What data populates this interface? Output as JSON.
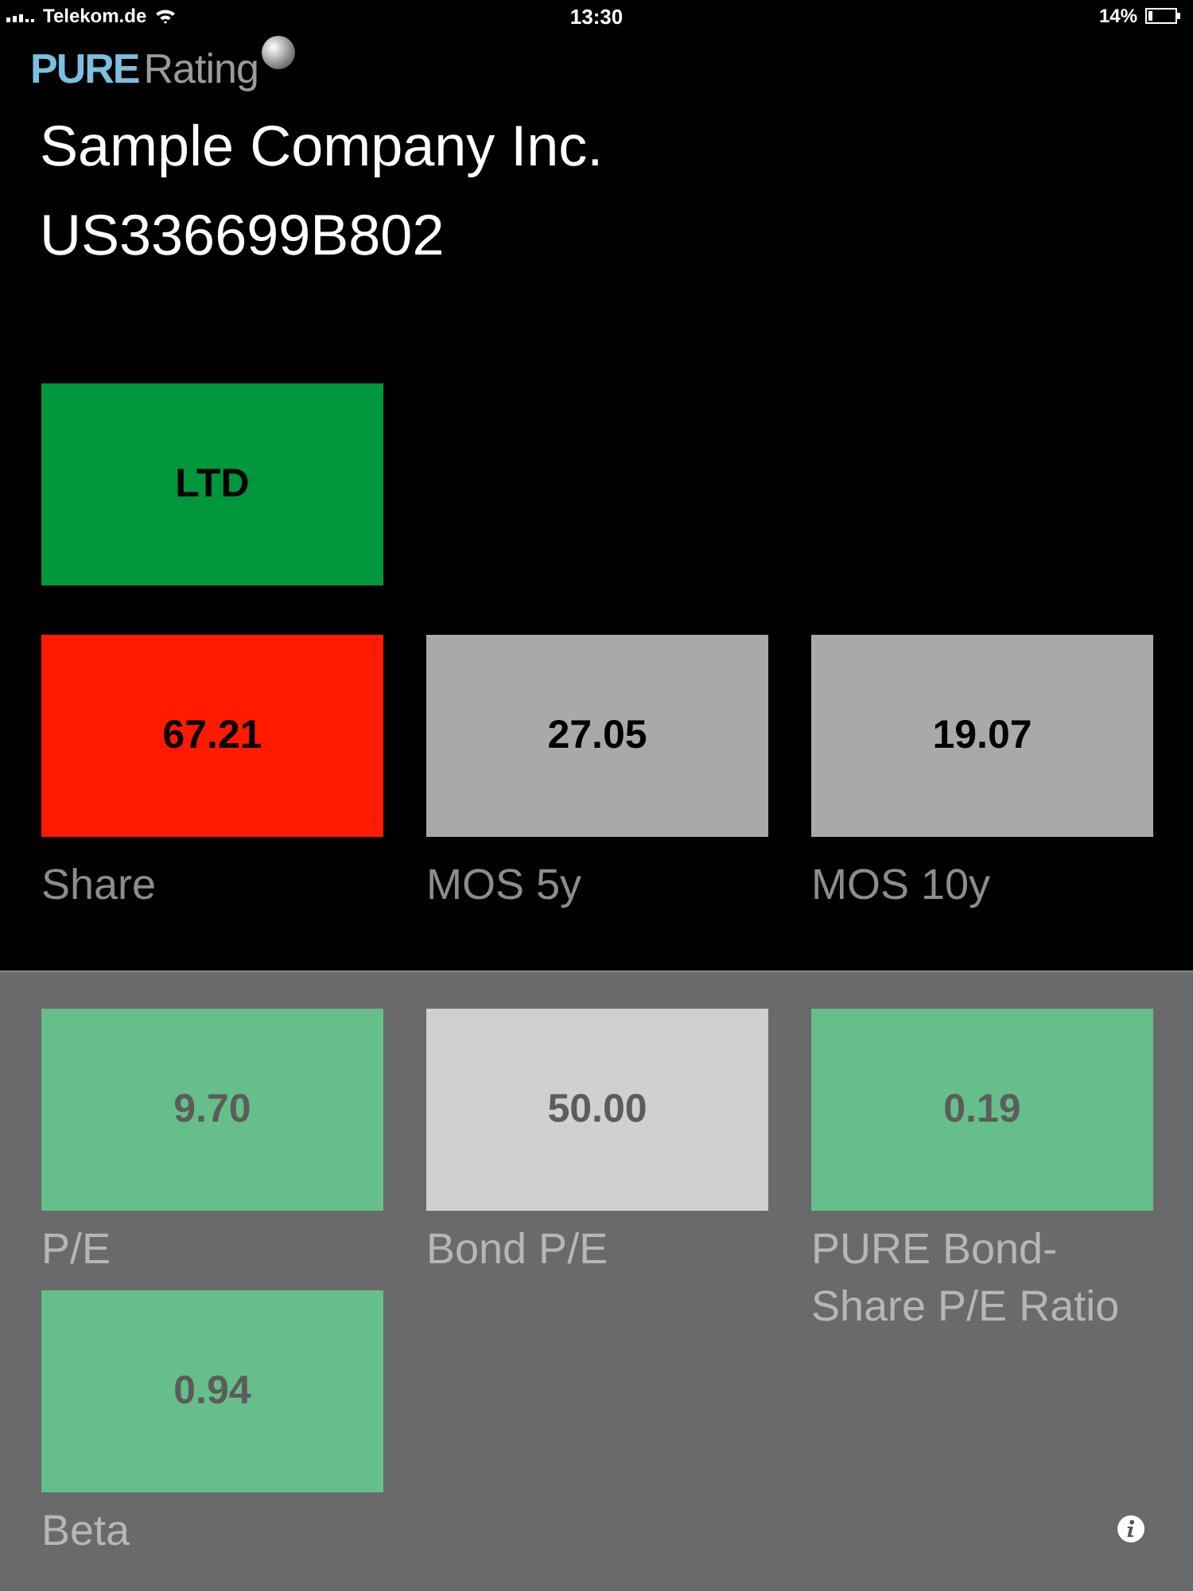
{
  "status_bar": {
    "carrier": "Telekom.de",
    "time": "13:30",
    "battery": "14%"
  },
  "logo": {
    "strong": "PURE",
    "light": "Rating"
  },
  "company": {
    "name": "Sample Company Inc.",
    "isin": "US336699B802"
  },
  "rating": {
    "value": "LTD",
    "color": "#00963c"
  },
  "primary_metrics": [
    {
      "value": "67.21",
      "label": "Share",
      "color": "#ff1a00"
    },
    {
      "value": "27.05",
      "label": "MOS 5y",
      "color": "#a9a8aa"
    },
    {
      "value": "19.07",
      "label": "MOS 10y",
      "color": "#a9a8aa"
    }
  ],
  "secondary_metrics": [
    {
      "value": "9.70",
      "label": "P/E",
      "color": "#66bf8a"
    },
    {
      "value": "50.00",
      "label": "Bond P/E",
      "color": "#d0cfd2"
    },
    {
      "value": "0.19",
      "label": "PURE Bond-Share P/E Ratio",
      "color": "#66bf8a"
    },
    {
      "value": "0.94",
      "label": "Beta",
      "color": "#66bf8a"
    }
  ]
}
